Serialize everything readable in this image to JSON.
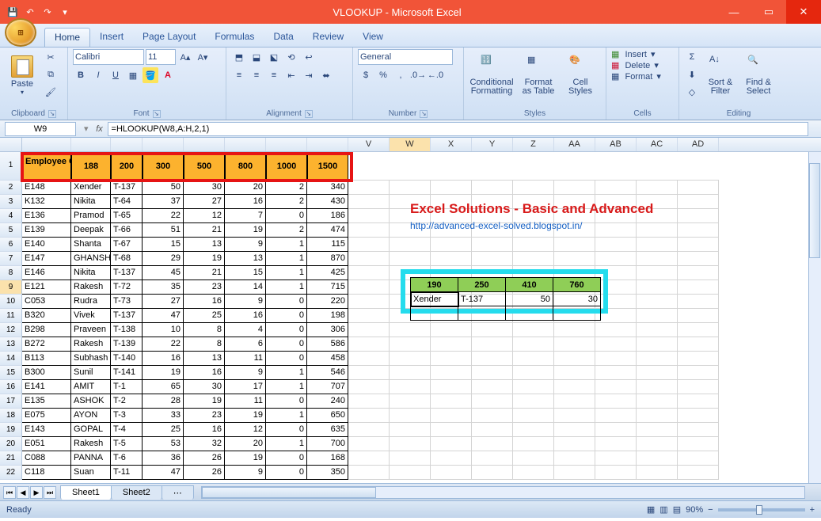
{
  "window": {
    "title": "VLOOKUP - Microsoft Excel"
  },
  "qat": {
    "save": "💾",
    "undo": "↶",
    "redo": "↷",
    "down": "▾"
  },
  "tabs": [
    "Home",
    "Insert",
    "Page Layout",
    "Formulas",
    "Data",
    "Review",
    "View"
  ],
  "ribbon": {
    "clipboard": {
      "title": "Clipboard",
      "paste": "Paste"
    },
    "font": {
      "title": "Font",
      "name": "Calibri",
      "size": "11"
    },
    "alignment": {
      "title": "Alignment"
    },
    "number": {
      "title": "Number",
      "format": "General"
    },
    "styles": {
      "title": "Styles",
      "cond": "Conditional\nFormatting",
      "fmt": "Format\nas Table",
      "cell": "Cell\nStyles"
    },
    "cells": {
      "title": "Cells",
      "insert": "Insert",
      "delete": "Delete",
      "format": "Format"
    },
    "editing": {
      "title": "Editing",
      "sort": "Sort &\nFilter",
      "find": "Find &\nSelect"
    }
  },
  "namebox": "W9",
  "formula": "=HLOOKUP(W8,A:H,2,1)",
  "columns": [
    {
      "w": 62
    },
    {
      "w": 50
    },
    {
      "w": 40
    },
    {
      "w": 52
    },
    {
      "w": 52
    },
    {
      "w": 52
    },
    {
      "w": 52
    },
    {
      "w": 52
    },
    {
      "w": 52
    },
    {
      "w": 52
    },
    {
      "w": 52
    },
    {
      "w": 52
    },
    {
      "w": 52
    },
    {
      "w": 52
    },
    {
      "w": 52
    },
    {
      "w": 52
    },
    {
      "w": 52
    }
  ],
  "colLabels": [
    "",
    "",
    "",
    "",
    "",
    "",
    "",
    "",
    "V",
    "W",
    "X",
    "Y",
    "Z",
    "AA",
    "AB",
    "AC",
    "AD"
  ],
  "header": [
    "Employee Code",
    "188",
    "200",
    "300",
    "500",
    "800",
    "1000",
    "1500"
  ],
  "rows": [
    {
      "n": 2,
      "c": [
        "E148",
        "Xender",
        "T-137",
        "50",
        "30",
        "20",
        "2",
        "340"
      ]
    },
    {
      "n": 3,
      "c": [
        "K132",
        "Nikita",
        "T-64",
        "37",
        "27",
        "16",
        "2",
        "430"
      ]
    },
    {
      "n": 4,
      "c": [
        "E136",
        "Pramod",
        "T-65",
        "22",
        "12",
        "7",
        "0",
        "186"
      ]
    },
    {
      "n": 5,
      "c": [
        "E139",
        "Deepak",
        "T-66",
        "51",
        "21",
        "19",
        "2",
        "474"
      ]
    },
    {
      "n": 6,
      "c": [
        "E140",
        "Shanta",
        "T-67",
        "15",
        "13",
        "9",
        "1",
        "115"
      ]
    },
    {
      "n": 7,
      "c": [
        "E147",
        "GHANSHU",
        "T-68",
        "29",
        "19",
        "13",
        "1",
        "870"
      ]
    },
    {
      "n": 8,
      "c": [
        "E146",
        "Nikita",
        "T-137",
        "45",
        "21",
        "15",
        "1",
        "425"
      ]
    },
    {
      "n": 9,
      "c": [
        "E121",
        "Rakesh",
        "T-72",
        "35",
        "23",
        "14",
        "1",
        "715"
      ]
    },
    {
      "n": 10,
      "c": [
        "C053",
        "Rudra",
        "T-73",
        "27",
        "16",
        "9",
        "0",
        "220"
      ]
    },
    {
      "n": 11,
      "c": [
        "B320",
        "Vivek",
        "T-137",
        "47",
        "25",
        "16",
        "0",
        "198"
      ]
    },
    {
      "n": 12,
      "c": [
        "B298",
        "Praveen",
        "T-138",
        "10",
        "8",
        "4",
        "0",
        "306"
      ]
    },
    {
      "n": 13,
      "c": [
        "B272",
        "Rakesh",
        "T-139",
        "22",
        "8",
        "6",
        "0",
        "586"
      ]
    },
    {
      "n": 14,
      "c": [
        "B113",
        "Subhash",
        "T-140",
        "16",
        "13",
        "11",
        "0",
        "458"
      ]
    },
    {
      "n": 15,
      "c": [
        "B300",
        "Sunil",
        "T-141",
        "19",
        "16",
        "9",
        "1",
        "546"
      ]
    },
    {
      "n": 16,
      "c": [
        "E141",
        "AMIT",
        "T-1",
        "65",
        "30",
        "17",
        "1",
        "707"
      ]
    },
    {
      "n": 17,
      "c": [
        "E135",
        "ASHOK",
        "T-2",
        "28",
        "19",
        "11",
        "0",
        "240"
      ]
    },
    {
      "n": 18,
      "c": [
        "E075",
        "AYON",
        "T-3",
        "33",
        "23",
        "19",
        "1",
        "650"
      ]
    },
    {
      "n": 19,
      "c": [
        "E143",
        "GOPAL",
        "T-4",
        "25",
        "16",
        "12",
        "0",
        "635"
      ]
    },
    {
      "n": 20,
      "c": [
        "E051",
        "Rakesh",
        "T-5",
        "53",
        "32",
        "20",
        "1",
        "700"
      ]
    },
    {
      "n": 21,
      "c": [
        "C088",
        "PANNA",
        "T-6",
        "36",
        "26",
        "19",
        "0",
        "168"
      ]
    },
    {
      "n": 22,
      "c": [
        "C118",
        "Suan",
        "T-11",
        "47",
        "26",
        "9",
        "0",
        "350"
      ]
    }
  ],
  "overlay": {
    "title": "Excel Solutions - Basic and Advanced",
    "link": "http://advanced-excel-solved.blogspot.in/"
  },
  "mini": {
    "headers": [
      "190",
      "250",
      "410",
      "760"
    ],
    "row": [
      "Xender",
      "T-137",
      "50",
      "30"
    ]
  },
  "sheets": [
    "Sheet1",
    "Sheet2"
  ],
  "status": {
    "ready": "Ready",
    "zoom": "90%"
  }
}
